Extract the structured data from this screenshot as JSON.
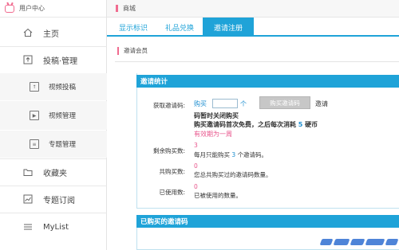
{
  "app": {
    "brand_label": "用户中心"
  },
  "sidebar": {
    "items": [
      {
        "label": "主页",
        "icon": "home-icon"
      },
      {
        "label": "投稿·管理",
        "icon": "upload-icon"
      },
      {
        "label": "视频投稿",
        "icon": "video-upload-icon"
      },
      {
        "label": "视频管理",
        "icon": "video-manage-icon"
      },
      {
        "label": "专题管理",
        "icon": "topic-manage-icon"
      },
      {
        "label": "收藏夹",
        "icon": "folder-icon"
      },
      {
        "label": "专题订阅",
        "icon": "chart-icon"
      },
      {
        "label": "MyList",
        "icon": "list-icon"
      }
    ]
  },
  "breadcrumb": {
    "label": "商城"
  },
  "tabs": [
    {
      "label": "显示标识",
      "active": false
    },
    {
      "label": "礼品兑换",
      "active": false
    },
    {
      "label": "邀请注册",
      "active": true
    }
  ],
  "section": {
    "title": "邀请会员"
  },
  "stats": {
    "header": "邀请统计",
    "get_code_label": "获取邀请码:",
    "buy_label": "购买",
    "unit_label": "个",
    "buy_button": "购买邀请码",
    "invite_label": "邀请",
    "notice_line1": "码暂时关闭购买",
    "notice_line2_prefix": "购买邀请码首次免费，之后每次消耗",
    "notice_line2_num": "5",
    "notice_line2_suffix": "硬币",
    "validity": "有效期为一周",
    "remaining_label": "剩余购买数:",
    "remaining_value": "3",
    "remaining_desc_prefix": "每月只能购买",
    "remaining_desc_num": "3",
    "remaining_desc_suffix": "个邀请码。",
    "total_label": "共购买数:",
    "total_value": "0",
    "total_desc": "您总共购买过的邀请码数量。",
    "used_label": "已使用数:",
    "used_value": "0",
    "used_desc": "已被使用的数量。"
  },
  "purchased": {
    "header": "已购买的邀请码"
  },
  "colors": {
    "accent": "#1fa3d8",
    "pink": "#e8558c"
  }
}
